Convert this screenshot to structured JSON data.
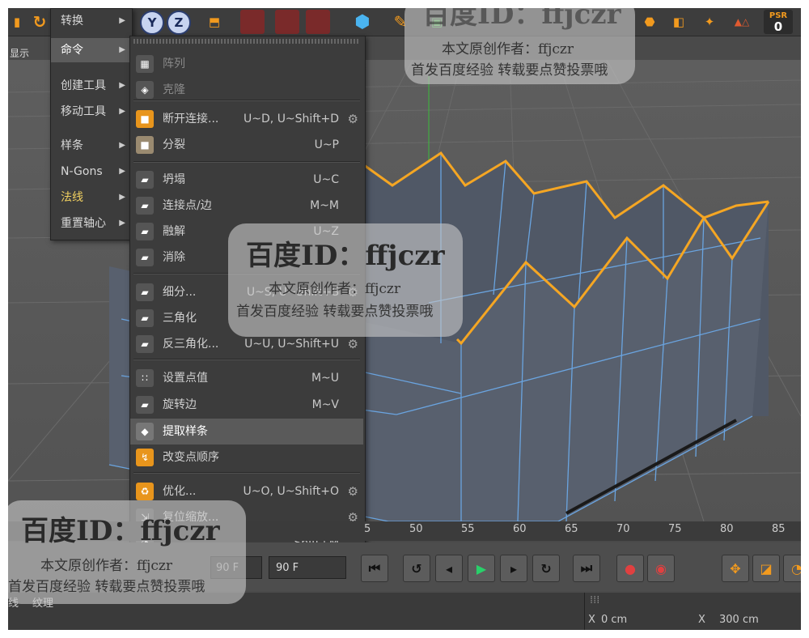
{
  "toolbar": {
    "psr_label": "PSR",
    "psr_value": "0"
  },
  "subbar": {
    "label": "显示"
  },
  "menu1": {
    "items": [
      {
        "label": "转换",
        "submenu": true
      },
      {
        "label": "命令",
        "submenu": true
      },
      {
        "label": "创建工具",
        "submenu": true
      },
      {
        "label": "移动工具",
        "submenu": true
      },
      {
        "label": "样条",
        "submenu": true
      },
      {
        "label": "N-Gons",
        "submenu": true
      },
      {
        "label": "法线",
        "submenu": true
      },
      {
        "label": "重置轴心",
        "submenu": true
      }
    ]
  },
  "menu2": {
    "items": [
      {
        "label": "阵列",
        "shortcut": ""
      },
      {
        "label": "克隆",
        "shortcut": ""
      },
      {
        "label": "断开连接...",
        "shortcut": "U~D, U~Shift+D"
      },
      {
        "label": "分裂",
        "shortcut": "U~P"
      },
      {
        "label": "坍塌",
        "shortcut": "U~C"
      },
      {
        "label": "连接点/边",
        "shortcut": "M~M"
      },
      {
        "label": "融解",
        "shortcut": "U~Z"
      },
      {
        "label": "消除",
        "shortcut": ""
      },
      {
        "label": "细分...",
        "shortcut": "U~S, U~Shift+S"
      },
      {
        "label": "三角化",
        "shortcut": ""
      },
      {
        "label": "反三角化...",
        "shortcut": "U~U, U~Shift+U"
      },
      {
        "label": "设置点值",
        "shortcut": "M~U"
      },
      {
        "label": "旋转边",
        "shortcut": "M~V"
      },
      {
        "label": "提取样条",
        "shortcut": ""
      },
      {
        "label": "改变点顺序",
        "shortcut": ""
      },
      {
        "label": "优化...",
        "shortcut": "U~O, U~Shift+O"
      },
      {
        "label": "复位缩放...",
        "shortcut": ""
      },
      {
        "label": "",
        "shortcut": "Shift+M"
      }
    ]
  },
  "timeline": {
    "ticks": [
      "5",
      "50",
      "55",
      "60",
      "65",
      "70",
      "75",
      "80",
      "85"
    ]
  },
  "controls": {
    "frame_start": "90 F",
    "frame_end": "90 F"
  },
  "bottombar": {
    "tab1": "线",
    "tab2": "纹理",
    "x_label": "X",
    "x_value": "0 cm",
    "x2_label": "X",
    "x2_value": "300 cm"
  },
  "watermark": {
    "id": "百度ID：ffjczr",
    "line1": "本文原创作者：ffjczr",
    "line2": "首发百度经验 转载要点赞投票哦"
  },
  "colors": {
    "accent": "#f29a1e",
    "edge": "#7ab0e8",
    "highlight": "#f5a623"
  }
}
